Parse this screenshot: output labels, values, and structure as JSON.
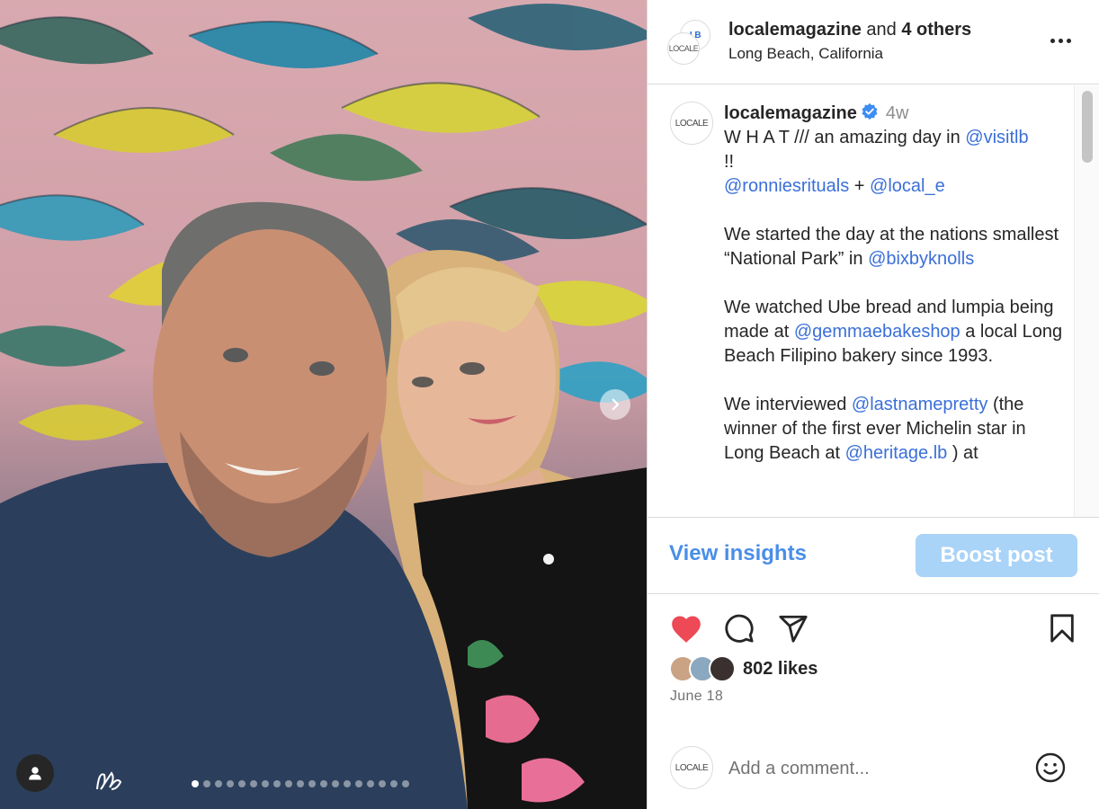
{
  "header": {
    "username": "localemagazine",
    "collab_suffix": " and ",
    "collab_count": "4 others",
    "location": "Long Beach, California",
    "avatar_back_text": "LB",
    "avatar_front_text": "LOCALE",
    "more_icon": "more-horizontal-icon"
  },
  "caption": {
    "avatar_text": "LOCALE",
    "username": "localemagazine",
    "verified_icon": "verified-badge-icon",
    "age": "4w",
    "line1_text": "W H A T /// an amazing day in ",
    "line1_mention": "@visitlb",
    "line2_text": "!!",
    "line3_mention_a": "@ronniesrituals",
    "line3_plus": " + ",
    "line3_mention_b": "@local_e",
    "p2_text": "We started the day at the nations smallest “National Park” in ",
    "p2_mention": "@bixbyknolls",
    "p3_text_a": "We watched Ube bread and lumpia being made at ",
    "p3_mention": "@gemmaebakeshop",
    "p3_text_b": " a local Long Beach Filipino bakery since 1993.",
    "p4_text_a": "We interviewed ",
    "p4_mention_a": "@lastnamepretty",
    "p4_text_b": " (the winner of the first ever Michelin star in Long Beach at ",
    "p4_mention_b": "@heritage.lb",
    "p4_text_c": " ) at"
  },
  "insights": {
    "view_label": "View insights",
    "boost_label": "Boost post"
  },
  "actions": {
    "like_icon": "heart-filled-icon",
    "comment_icon": "comment-icon",
    "share_icon": "share-icon",
    "save_icon": "bookmark-icon",
    "likes_text": "802 likes",
    "date": "June 18",
    "like_color": "#ed4956"
  },
  "comment_bar": {
    "avatar_text": "LOCALE",
    "placeholder": "Add a comment...",
    "emoji_icon": "emoji-smiley-icon"
  },
  "media": {
    "next_icon": "chevron-right-icon",
    "tag_icon": "person-tag-icon",
    "carousel_total": 19,
    "carousel_active": 1
  },
  "colors": {
    "link": "#3a6fd8",
    "boost_bg": "#a9d3f7",
    "insights_text": "#4a8ee8"
  }
}
